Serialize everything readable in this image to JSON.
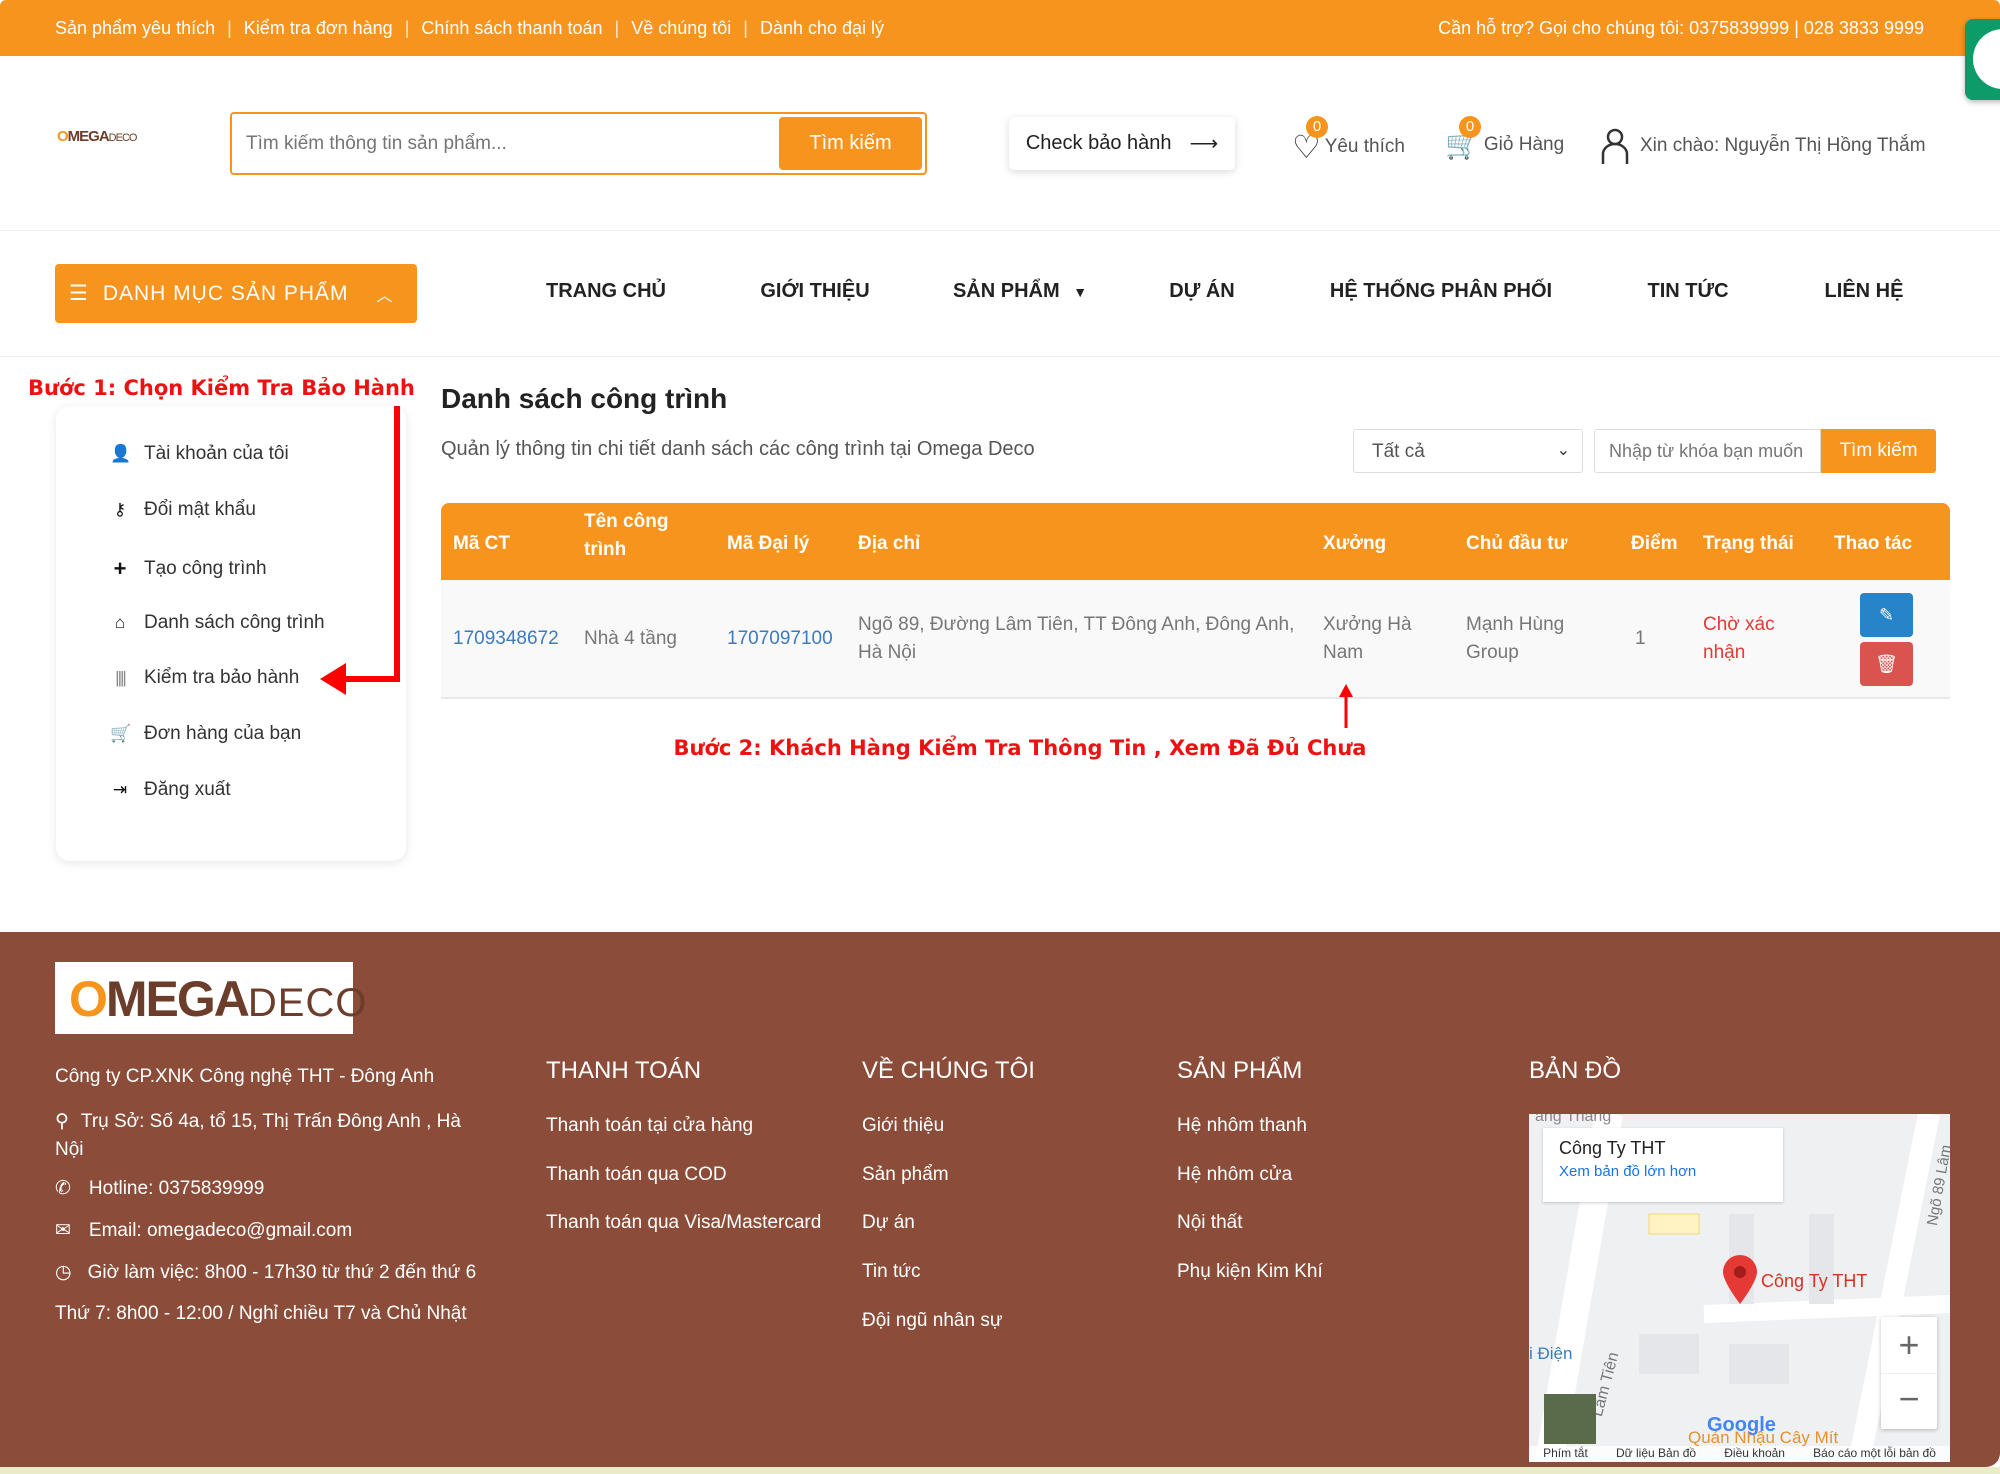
{
  "topbar": {
    "links": [
      "Sản phẩm yêu thích",
      "Kiểm tra đơn hàng",
      "Chính sách thanh toán",
      "Về chúng tôi",
      "Dành cho đại lý"
    ],
    "support": "Cần hỗ trợ? Gọi cho chúng tôi: 0375839999 | 028 3833 9999"
  },
  "header": {
    "logo": "OMEGA DECO",
    "search_placeholder": "Tìm kiếm thông tin sản phẩm...",
    "search_button": "Tìm kiếm",
    "check_warranty": "Check bảo hành",
    "wishlist_label": "Yêu thích",
    "wishlist_count": "0",
    "cart_label": "Giỏ Hàng",
    "cart_count": "0",
    "greeting": "Xin chào: Nguyễn Thị Hồng Thắm",
    "accent": "#f7941d"
  },
  "nav": {
    "category_button": "DANH MỤC SẢN PHẨM",
    "items": [
      "TRANG CHỦ",
      "GIỚI THIỆU",
      "SẢN PHẨM",
      "DỰ ÁN",
      "HỆ THỐNG PHÂN PHỐI",
      "TIN TỨC",
      "LIÊN HỆ"
    ]
  },
  "annotations": {
    "step1": "Bước 1: Chọn Kiểm Tra Bảo Hành",
    "step2": "Bước 2: Khách Hàng Kiểm Tra Thông Tin , Xem Đã Đủ Chưa"
  },
  "sidebar": {
    "items": [
      {
        "label": "Tài khoản của tôi",
        "icon": "user-icon"
      },
      {
        "label": "Đổi mật khẩu",
        "icon": "key-icon"
      },
      {
        "label": "Tạo công trình",
        "icon": "plus-icon"
      },
      {
        "label": "Danh sách công trình",
        "icon": "home-icon"
      },
      {
        "label": "Kiểm tra bảo hành",
        "icon": "barcode-icon"
      },
      {
        "label": "Đơn hàng của bạn",
        "icon": "cart-icon"
      },
      {
        "label": "Đăng xuất",
        "icon": "logout-icon"
      }
    ]
  },
  "main": {
    "title": "Danh sách công trình",
    "subtitle": "Quản lý thông tin chi tiết danh sách các công trình tại Omega Deco",
    "filter_value": "Tất cả",
    "keyword_placeholder": "Nhập từ khóa bạn muốn",
    "search_button": "Tìm kiếm",
    "table": {
      "headers": [
        "Mã CT",
        "Tên công trình",
        "Mã Đại lý",
        "Địa chỉ",
        "Xưởng",
        "Chủ đầu tư",
        "Điểm",
        "Trạng thái",
        "Thao tác"
      ],
      "rows": [
        {
          "ma_ct": "1709348672",
          "ten": "Nhà 4 tầng",
          "ma_dai_ly": "1707097100",
          "dia_chi": "Ngõ 89, Đường Lâm Tiên, TT Đông Anh, Đông Anh, Hà Nội",
          "xuong": "Xưởng Hà Nam",
          "chu_dau_tu": "Mạnh Hùng Group",
          "diem": "1",
          "trang_thai": "Chờ xác nhận"
        }
      ]
    }
  },
  "footer": {
    "logo": "OMEGA DECO",
    "company": "Công ty CP.XNK Công nghệ THT - Đông Anh",
    "address": "Trụ Sở: Số 4a, tổ 15, Thị Trấn Đông Anh , Hà Nội",
    "hotline": "Hotline: 0375839999",
    "email": "Email: omegadeco@gmail.com",
    "hours": "Giờ làm việc: 8h00 - 17h30 từ thứ 2 đến thứ 6",
    "saturday": "Thứ 7: 8h00 - 12:00 / Nghỉ chiều T7 và Chủ Nhật",
    "cols": [
      {
        "title": "THANH TOÁN",
        "links": [
          "Thanh toán tại cửa hàng",
          "Thanh toán qua COD",
          "Thanh toán qua Visa/Mastercard"
        ]
      },
      {
        "title": "VỀ CHÚNG TÔI",
        "links": [
          "Giới thiệu",
          "Sản phẩm",
          "Dự án",
          "Tin tức",
          "Đội ngũ nhân sự"
        ]
      },
      {
        "title": "SẢN PHẨM",
        "links": [
          "Hệ nhôm thanh",
          "Hệ nhôm cửa",
          "Nội thất",
          "Phụ kiện Kim Khí"
        ]
      }
    ],
    "map_title": "BẢN ĐỒ",
    "map": {
      "place": "Công Ty THT",
      "larger": "Xem bản đồ lớn hơn",
      "marker_label": "Công Ty THT",
      "streets": [
        "ang Thang",
        "Ngõ 89 Lâm",
        "Lâm Tiên",
        "i Điện",
        "Quán Nhậu Cây Mít"
      ],
      "google": "Google",
      "footer_links": [
        "Phím tắt",
        "Dữ liệu Bản đồ",
        "Điều khoản",
        "Báo cáo một lỗi bản đồ"
      ],
      "brown": "#8b4d39"
    }
  }
}
